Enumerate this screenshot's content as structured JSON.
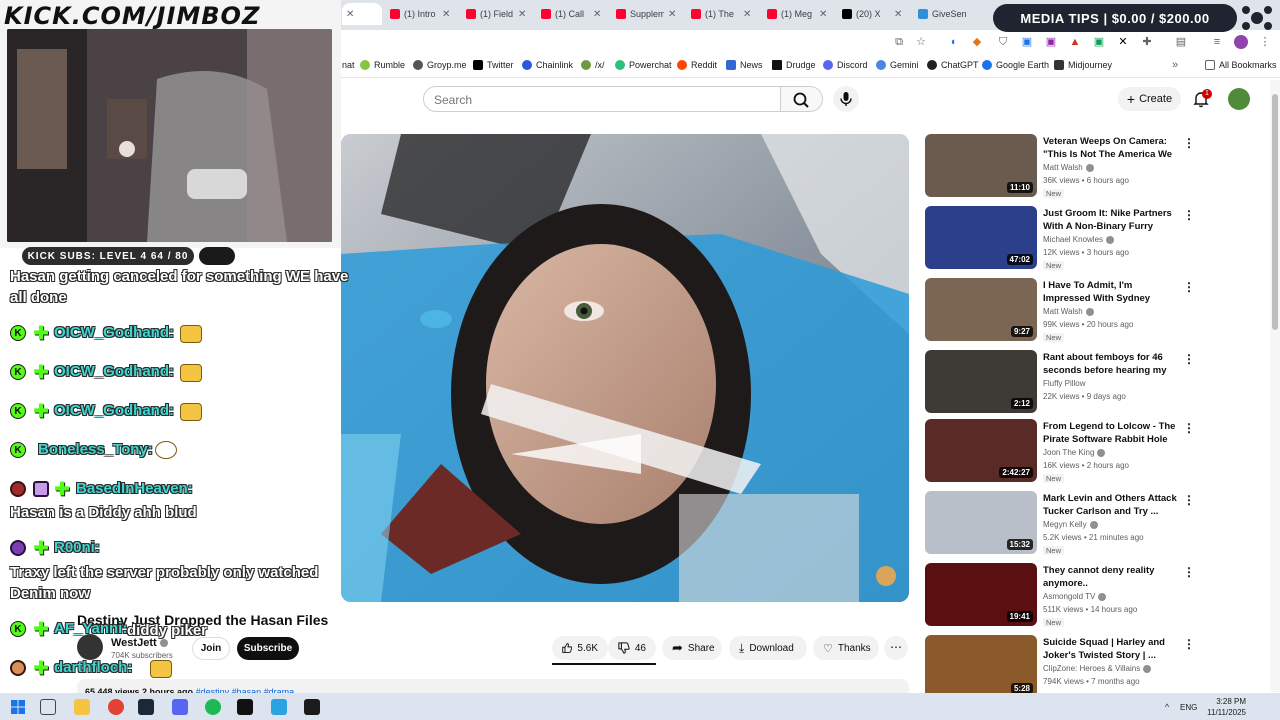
{
  "browser": {
    "tabs": [
      {
        "title": "",
        "color": "#202124",
        "active": true
      },
      {
        "title": "(1) Intro",
        "color": "#ff0033"
      },
      {
        "title": "(1) Field",
        "color": "#ff0033"
      },
      {
        "title": "(1) Call",
        "color": "#ff0033"
      },
      {
        "title": "Supplem",
        "color": "#ff0033"
      },
      {
        "title": "(1) The",
        "color": "#ff0033"
      },
      {
        "title": "(1) Meg",
        "color": "#ff0033"
      },
      {
        "title": "(20) X",
        "color": "#000000"
      },
      {
        "title": "GiveSen",
        "color": "#2f8fd8"
      }
    ],
    "bookmarks": [
      {
        "label": "nat",
        "color": "#9aa0a6"
      },
      {
        "label": "Rumble",
        "color": "#85c742"
      },
      {
        "label": "Groyp.me",
        "color": "#555555"
      },
      {
        "label": "Twitter",
        "color": "#000000"
      },
      {
        "label": "Chainlink",
        "color": "#2a5ada"
      },
      {
        "label": "/x/",
        "color": "#6f9b3f"
      },
      {
        "label": "Powerchat",
        "color": "#2ac17a"
      },
      {
        "label": "Reddit",
        "color": "#ff4500"
      },
      {
        "label": "News",
        "color": "#3367d6"
      },
      {
        "label": "Drudge",
        "color": "#111111"
      },
      {
        "label": "Discord",
        "color": "#5865f2"
      },
      {
        "label": "Gemini",
        "color": "#4a86e8"
      },
      {
        "label": "ChatGPT",
        "color": "#202124"
      },
      {
        "label": "Google Earth",
        "color": "#1a73e8"
      },
      {
        "label": "Midjourney",
        "color": "#333333"
      }
    ],
    "all_bookmarks": "All Bookmarks"
  },
  "youtube": {
    "search_placeholder": "Search",
    "create_label": "Create",
    "notification_count": "1",
    "video": {
      "title": "Destiny Just Dropped the Hasan Files",
      "channel": "WestJett",
      "subscribers": "704K subscribers",
      "join_label": "Join",
      "subscribe_label": "Subscribe",
      "likes": "5.6K",
      "dislikes": "46",
      "share_label": "Share",
      "download_label": "Download",
      "thanks_label": "Thanks",
      "views_line": "65,448 views  2 hours ago",
      "tags": "#destiny #hasan #drama"
    },
    "recommendations": [
      {
        "title": "Veteran Weeps On Camera: \"This Is Not The America We ...",
        "channel": "Matt Walsh",
        "verified": true,
        "meta": "36K views • 6 hours ago",
        "badge": "New",
        "duration": "11:10",
        "thumb": "#6b5a4e"
      },
      {
        "title": "Just Groom It: Nike Partners With A Non-Binary Furry",
        "channel": "Michael Knowles",
        "verified": true,
        "meta": "12K views • 3 hours ago",
        "badge": "New",
        "duration": "47:02",
        "thumb": "#2c3f8a"
      },
      {
        "title": "I Have To Admit, I'm Impressed With Sydney Sweeney's Non ...",
        "channel": "Matt Walsh",
        "verified": true,
        "meta": "99K views • 20 hours ago",
        "badge": "New",
        "duration": "9:27",
        "thumb": "#7a6652"
      },
      {
        "title": "Rant about femboys for 46 seconds before hearing my ...",
        "channel": "Fluffy Pillow",
        "verified": false,
        "meta": "22K views • 9 days ago",
        "badge": "",
        "duration": "2:12",
        "thumb": "#3e3a36"
      },
      {
        "title": "From Legend to Lolcow - The Pirate Software Rabbit Hole",
        "channel": "Joon The King",
        "verified": true,
        "meta": "16K views • 2 hours ago",
        "badge": "New",
        "duration": "2:42:27",
        "thumb": "#5a2a26"
      },
      {
        "title": "Mark Levin and Others Attack Tucker Carlson and Try ...",
        "channel": "Megyn Kelly",
        "verified": true,
        "meta": "5.2K views • 21 minutes ago",
        "badge": "New",
        "duration": "15:32",
        "thumb": "#b9bfc8"
      },
      {
        "title": "They cannot deny reality anymore..",
        "channel": "Asmongold TV",
        "verified": true,
        "meta": "511K views • 14 hours ago",
        "badge": "New",
        "duration": "19:41",
        "thumb": "#5a1010"
      },
      {
        "title": "Suicide Squad | Harley and Joker's Twisted Story | ...",
        "channel": "ClipZone: Heroes & Villains",
        "verified": true,
        "meta": "794K views • 7 months ago",
        "badge": "",
        "duration": "5:28",
        "thumb": "#8a5a2a"
      }
    ]
  },
  "overlay": {
    "brand": "KICK.COM/JIMBOZ",
    "kick_subs": "KICK SUBS: LEVEL 4 64 / 80",
    "media_tips": "MEDIA TIPS | $0.00 / $200.00",
    "chat": [
      {
        "type": "msg",
        "text": "Hasan getting canceled for something WE have"
      },
      {
        "type": "msg",
        "text": "all done"
      },
      {
        "type": "user",
        "text": "OICW_Godhand:"
      },
      {
        "type": "user",
        "text": "OICW_Godhand:"
      },
      {
        "type": "user",
        "text": "OICW_Godhand:"
      },
      {
        "type": "user",
        "text": "Boneless_Tony:"
      },
      {
        "type": "user",
        "text": "BasedInHeaven:"
      },
      {
        "type": "msg",
        "text": "Hasan is a Diddy ahh blud"
      },
      {
        "type": "user",
        "text": "R00ni:"
      },
      {
        "type": "msg",
        "text": "Traxy left the server probably only watched"
      },
      {
        "type": "msg",
        "text": "Denim now"
      },
      {
        "type": "user",
        "text": "AF_Yanni:"
      },
      {
        "type": "msg",
        "text": "diddy piker"
      },
      {
        "type": "user",
        "text": "darthfloch:"
      }
    ]
  },
  "taskbar": {
    "lang": "ENG",
    "time": "3:28 PM",
    "date": "11/11/2025"
  }
}
